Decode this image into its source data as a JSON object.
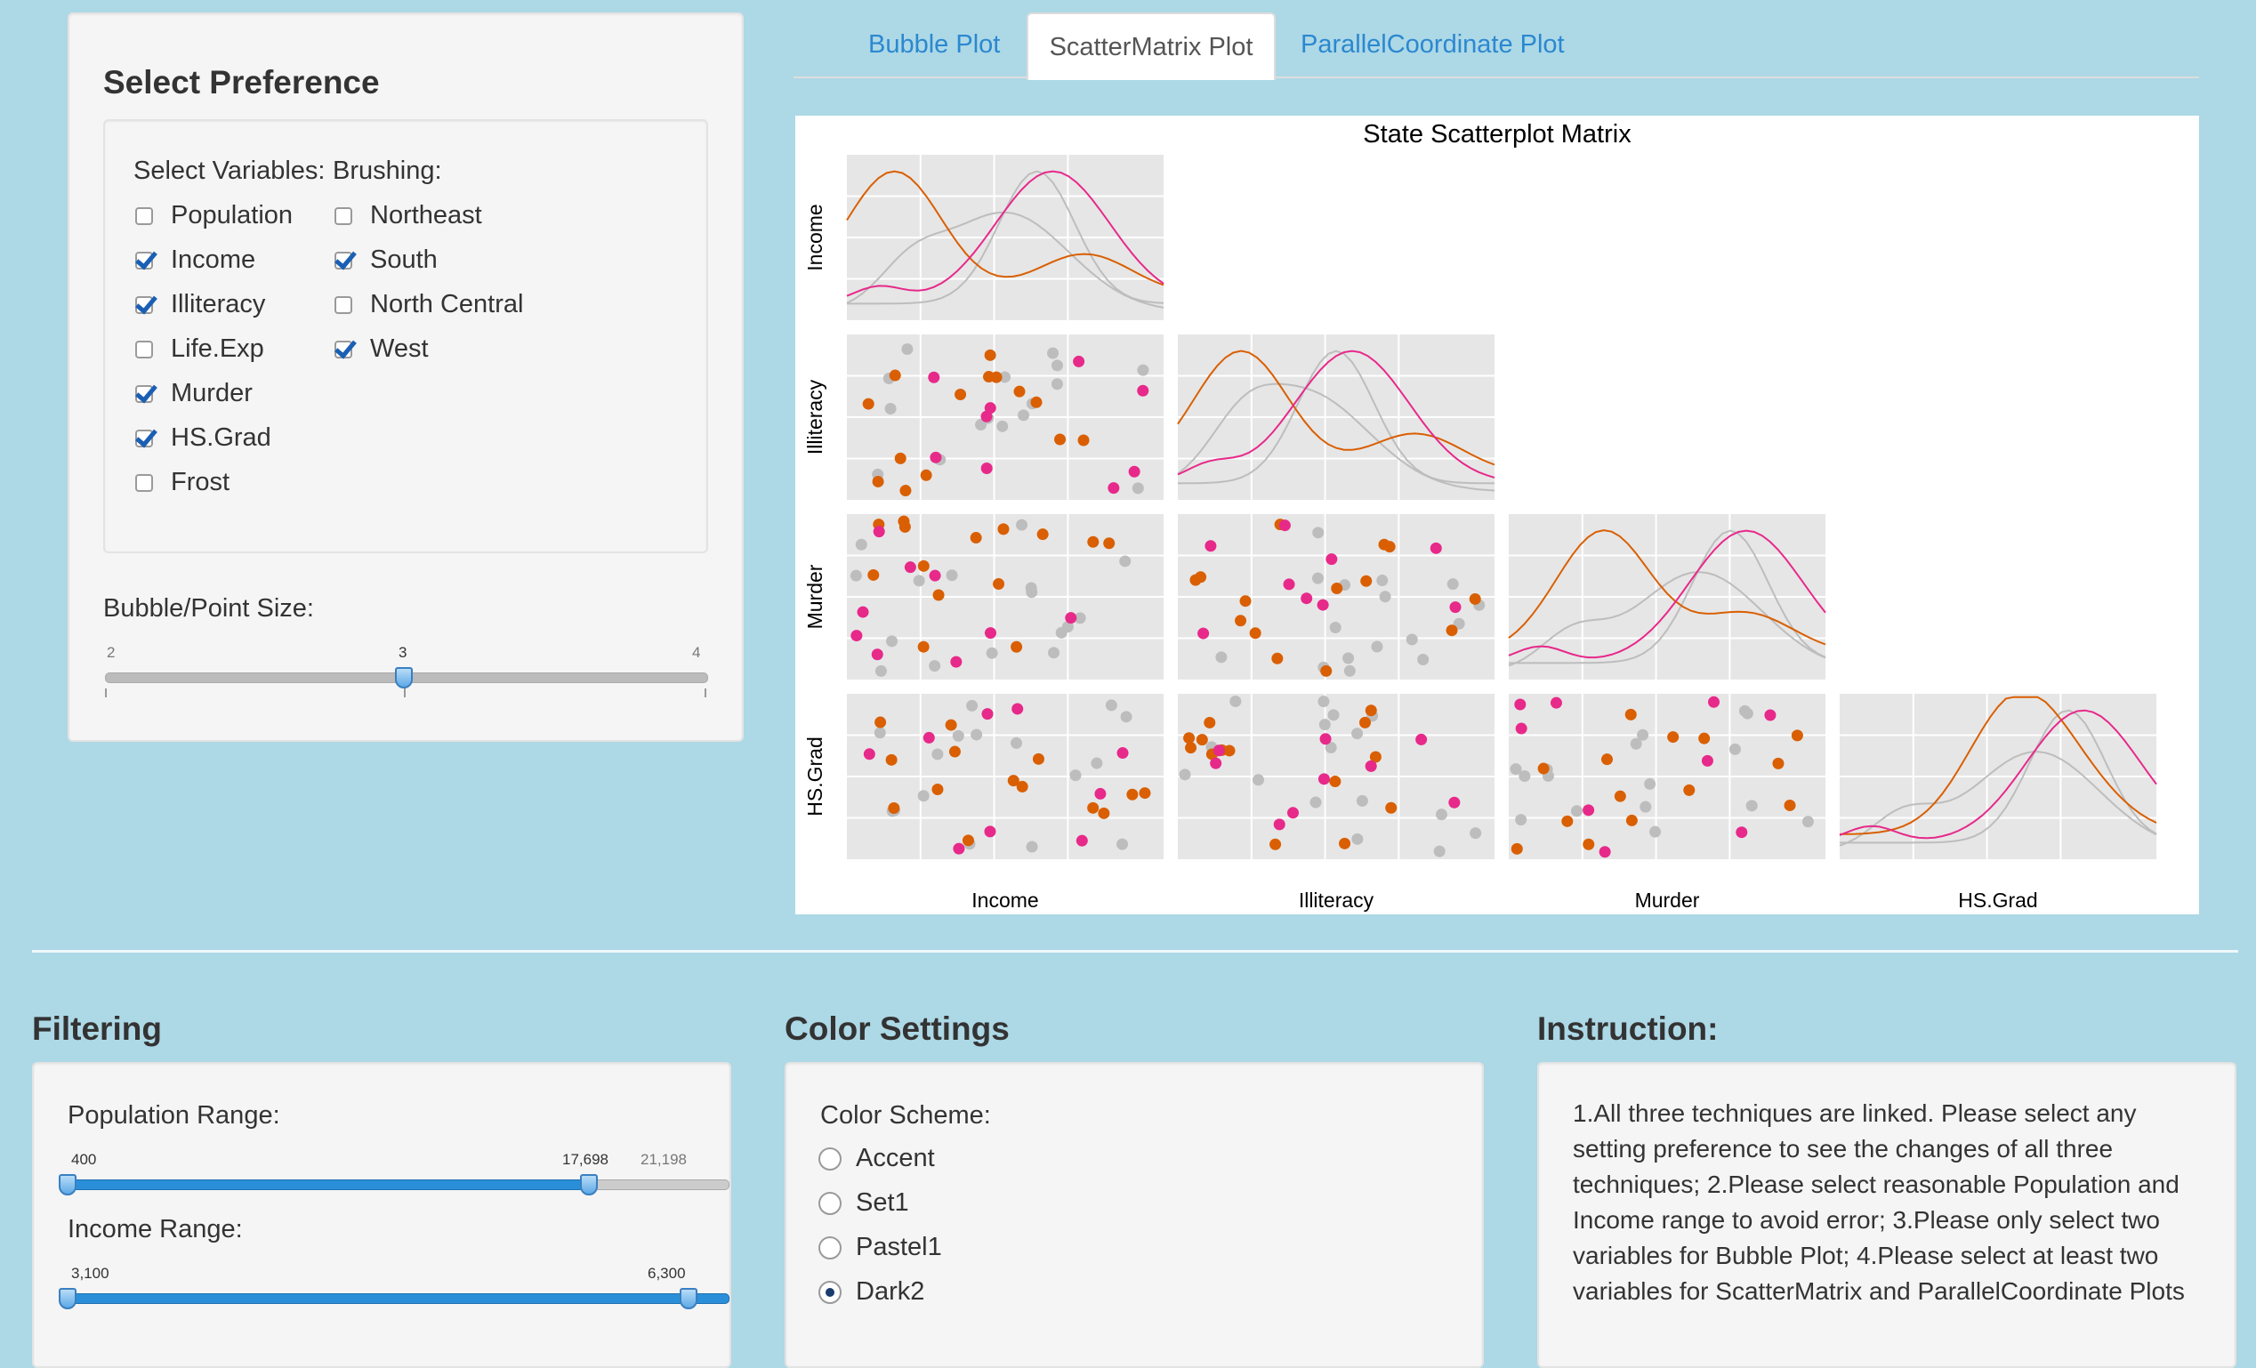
{
  "preferences": {
    "title": "Select Preference",
    "variables_label": "Select Variables:",
    "brushing_label": "Brushing:",
    "variables": [
      {
        "label": "Population",
        "checked": false
      },
      {
        "label": "Income",
        "checked": true
      },
      {
        "label": "Illiteracy",
        "checked": true
      },
      {
        "label": "Life.Exp",
        "checked": false
      },
      {
        "label": "Murder",
        "checked": true
      },
      {
        "label": "HS.Grad",
        "checked": true
      },
      {
        "label": "Frost",
        "checked": false
      }
    ],
    "brushing": [
      {
        "label": "Northeast",
        "checked": false
      },
      {
        "label": "South",
        "checked": true
      },
      {
        "label": "North Central",
        "checked": false
      },
      {
        "label": "West",
        "checked": true
      }
    ],
    "point_size": {
      "label": "Bubble/Point Size:",
      "min": "2",
      "max": "4",
      "value": "3",
      "fraction": 0.5
    }
  },
  "tabs": [
    {
      "label": "Bubble Plot",
      "active": false
    },
    {
      "label": "ScatterMatrix Plot",
      "active": true
    },
    {
      "label": "ParallelCoordinate Plot",
      "active": false
    }
  ],
  "plot": {
    "title": "State Scatterplot Matrix",
    "variables": [
      "Income",
      "Illiteracy",
      "Murder",
      "HS.Grad"
    ],
    "colors": {
      "south": "#d95f02",
      "west": "#e7298a",
      "other": "#bdbdbd",
      "panel": "#e6e6e6"
    }
  },
  "filtering": {
    "title": "Filtering",
    "population": {
      "label": "Population Range:",
      "min": "400",
      "max": "21,198",
      "from": "400",
      "to": "17,698",
      "from_frac": 0.0,
      "to_frac": 0.826
    },
    "income": {
      "label": "Income Range:",
      "min": "3,100",
      "max": "6,300",
      "from": "3,100",
      "to": "6,300",
      "from_frac": 0.0,
      "to_frac": 1.0
    }
  },
  "colors_section": {
    "title": "Color Settings",
    "scheme_label": "Color Scheme:",
    "options": [
      {
        "label": "Accent",
        "checked": false
      },
      {
        "label": "Set1",
        "checked": false
      },
      {
        "label": "Pastel1",
        "checked": false
      },
      {
        "label": "Dark2",
        "checked": true
      }
    ]
  },
  "instruction": {
    "title": "Instruction:",
    "lines": [
      "1.All three techniques are linked. Please select any",
      "setting preference to see the changes of all three",
      "techniques; 2.Please select reasonable Population and",
      "Income range to avoid error; 3.Please only select two",
      "variables for Bubble Plot; 4.Please select at least two",
      "variables for ScatterMatrix and ParallelCoordinate Plots"
    ]
  }
}
